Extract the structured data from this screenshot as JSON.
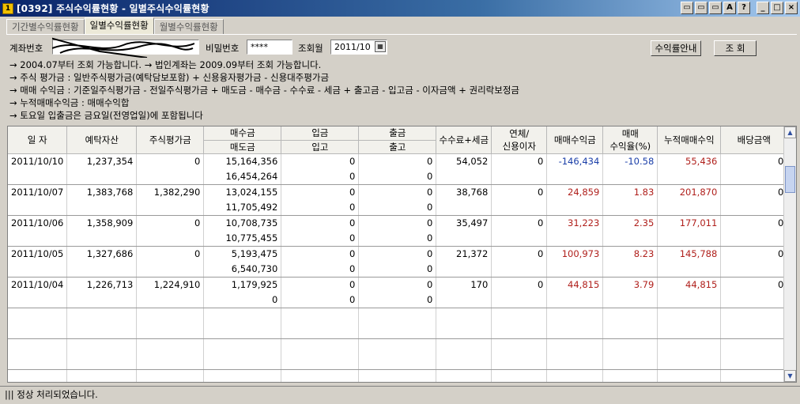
{
  "window": {
    "title": "[0392] 주식수익률현황 - 일별주식수익률현황",
    "app_icon": "1",
    "buttons": [
      "▭",
      "▭",
      "▭",
      "A",
      "?",
      "_",
      "□",
      "×"
    ]
  },
  "tabs": [
    {
      "label": "기간별수익률현황",
      "active": false
    },
    {
      "label": "일별수익률현황",
      "active": true
    },
    {
      "label": "월별수익률현황",
      "active": false
    }
  ],
  "query": {
    "account_label": "계좌번호",
    "password_label": "비밀번호",
    "password_value": "****",
    "month_label": "조회월",
    "month_value": "2011/10",
    "guide_button": "수익률안내",
    "search_button": "조  회"
  },
  "notes": [
    "→ 2004.07부터 조회 가능합니다. → 법인계좌는 2009.09부터 조회 가능합니다.",
    "→ 주식  평가금   : 일반주식평가금(예탁담보포함) + 신용융자평가금 - 신용대주평가금",
    "→ 매매  수익금   : 기준일주식평가금 - 전일주식평가금 + 매도금 - 매수금 - 수수료 - 세금 + 출고금 - 입고금 - 이자금액 + 권리락보정금",
    "→ 누적매매수익금 : 매매수익합",
    "→ 토요일 입출금은 금요일(전영업일)에 포함됩니다"
  ],
  "grid": {
    "headers": {
      "date": "일 자",
      "deposit": "예탁자산",
      "stock_eval": "주식평가금",
      "buy": "매수금",
      "sell": "매도금",
      "in_money": "입금",
      "in_stock": "입고",
      "out_money": "출금",
      "out_stock": "출고",
      "fee": "수수료+세금",
      "overdue_1": "연체/",
      "overdue_2": "신용이자",
      "profit": "매매수익금",
      "rate_1": "매매",
      "rate_2": "수익율(%)",
      "cum": "누적매매수익",
      "dividend": "배당금액"
    },
    "rows": [
      {
        "date": "2011/10/10",
        "deposit": "1,237,354",
        "stock_eval": "0",
        "buy": "15,164,356",
        "sell": "16,454,264",
        "in_money": "0",
        "in_stock": "0",
        "out_money": "0",
        "out_stock": "0",
        "fee": "54,052",
        "overdue": "0",
        "profit": "-146,434",
        "rate": "-10.58",
        "cum": "55,436",
        "dividend": "0"
      },
      {
        "date": "2011/10/07",
        "deposit": "1,383,768",
        "stock_eval": "1,382,290",
        "buy": "13,024,155",
        "sell": "11,705,492",
        "in_money": "0",
        "in_stock": "0",
        "out_money": "0",
        "out_stock": "0",
        "fee": "38,768",
        "overdue": "0",
        "profit": "24,859",
        "rate": "1.83",
        "cum": "201,870",
        "dividend": "0"
      },
      {
        "date": "2011/10/06",
        "deposit": "1,358,909",
        "stock_eval": "0",
        "buy": "10,708,735",
        "sell": "10,775,455",
        "in_money": "0",
        "in_stock": "0",
        "out_money": "0",
        "out_stock": "0",
        "fee": "35,497",
        "overdue": "0",
        "profit": "31,223",
        "rate": "2.35",
        "cum": "177,011",
        "dividend": "0"
      },
      {
        "date": "2011/10/05",
        "deposit": "1,327,686",
        "stock_eval": "0",
        "buy": "5,193,475",
        "sell": "6,540,730",
        "in_money": "0",
        "in_stock": "0",
        "out_money": "0",
        "out_stock": "0",
        "fee": "21,372",
        "overdue": "0",
        "profit": "100,973",
        "rate": "8.23",
        "cum": "145,788",
        "dividend": "0"
      },
      {
        "date": "2011/10/04",
        "deposit": "1,226,713",
        "stock_eval": "1,224,910",
        "buy": "1,179,925",
        "sell": "0",
        "in_money": "0",
        "in_stock": "0",
        "out_money": "0",
        "out_stock": "0",
        "fee": "170",
        "overdue": "0",
        "profit": "44,815",
        "rate": "3.79",
        "cum": "44,815",
        "dividend": "0"
      }
    ],
    "empty_row_pairs": 3
  },
  "colors": {
    "negative": "#1a3ea8",
    "positive": "#b0201c"
  },
  "status": {
    "text": "정상 처리되었습니다."
  }
}
